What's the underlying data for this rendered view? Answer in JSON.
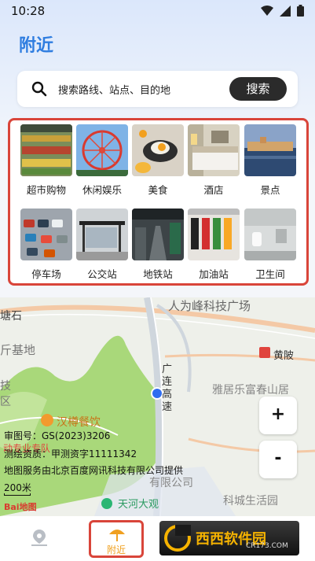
{
  "status": {
    "time": "10:28"
  },
  "page": {
    "title": "附近"
  },
  "search": {
    "placeholder": "搜索路线、站点、目的地",
    "button": "搜索"
  },
  "categories": [
    {
      "label": "超市购物",
      "icon": "supermarket"
    },
    {
      "label": "休闲娱乐",
      "icon": "ferris-wheel"
    },
    {
      "label": "美食",
      "icon": "food"
    },
    {
      "label": "酒店",
      "icon": "hotel"
    },
    {
      "label": "景点",
      "icon": "scenic"
    },
    {
      "label": "停车场",
      "icon": "parking"
    },
    {
      "label": "公交站",
      "icon": "bus-stop"
    },
    {
      "label": "地铁站",
      "icon": "subway"
    },
    {
      "label": "加油站",
      "icon": "gas-station"
    },
    {
      "label": "卫生间",
      "icon": "restroom"
    }
  ],
  "map": {
    "labels": {
      "road_top": "人为峰科技广场",
      "left_1": "塘石",
      "left_2": "斤基地",
      "left_3": "技",
      "left_4": "区",
      "huangpi": "黄陂",
      "highway": "广连高速",
      "hill": "雅居乐富春山居",
      "restaurant": "汉樽餐饮",
      "company": "有限公司",
      "community": "科城生活园",
      "park": "天河大观",
      "poi_red": "动专业专队"
    },
    "attribution": {
      "map_no": "审图号：GS(2023)3206",
      "survey": "测绘资质：甲测资字11111342",
      "provider": "地图服务由北京百度网讯科技有限公司提供",
      "scale": "200米",
      "logo": "Bai地图"
    },
    "zoom_in": "+",
    "zoom_out": "-"
  },
  "tabbar": {
    "near": "附近",
    "watermark": "西西软件园",
    "watermark_sub": "CR173.COM"
  }
}
